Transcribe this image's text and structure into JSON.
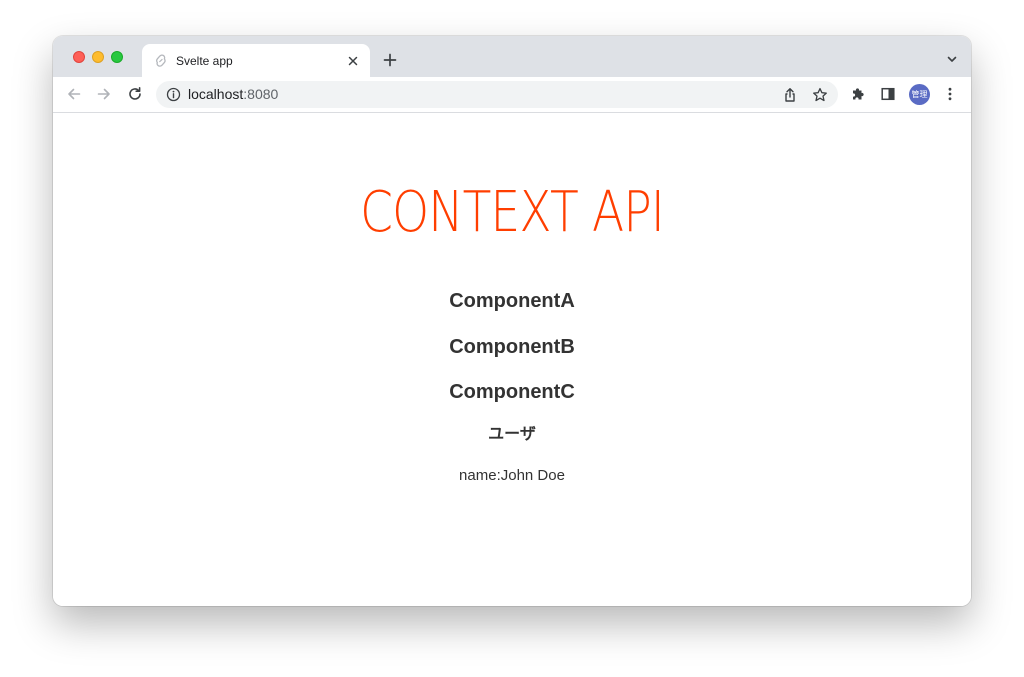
{
  "browser": {
    "tab": {
      "title": "Svelte app"
    },
    "address": {
      "host": "localhost",
      "port": ":8080"
    },
    "profile": {
      "label": "管理",
      "color": "#5a6bc4"
    }
  },
  "page": {
    "title": "CONTEXT API",
    "title_color": "#ff3e00",
    "components": [
      "ComponentA",
      "ComponentB",
      "ComponentC"
    ],
    "user_heading": "ユーザ",
    "user_name": "name:John Doe"
  },
  "icons": {
    "tab_favicon": "svelte-icon",
    "tab_close": "close-icon",
    "new_tab": "plus-icon",
    "tab_search": "chevron-down-icon",
    "back": "arrow-left-icon",
    "forward": "arrow-right-icon",
    "reload": "reload-icon",
    "site_info": "info-icon",
    "share": "share-icon",
    "bookmark": "star-icon",
    "extensions": "puzzle-icon",
    "side_panel": "side-panel-icon",
    "menu": "kebab-menu-icon"
  }
}
